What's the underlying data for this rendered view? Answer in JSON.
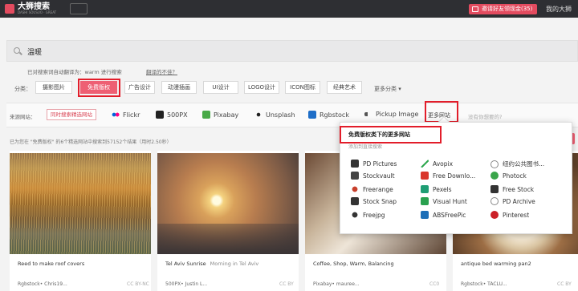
{
  "topbar": {
    "logo_text": "大狮搜索",
    "logo_sub": "DASHI SOUSUO · GREAT",
    "invite_label": "邀请好友领现金(35)",
    "user_label": "我的大狮"
  },
  "search": {
    "query": "温暖",
    "translate_note": "已对搜索词自动翻译为：warm 进行搜索",
    "unsatisfied": "翻译的不佳？"
  },
  "categories": {
    "label": "分类：",
    "items": [
      "摄影图片",
      "免费版权",
      "广告设计",
      "动漫插画",
      "UI设计",
      "LOGO设计",
      "ICON图标",
      "经典艺术"
    ],
    "active": "免费版权",
    "more": "更多分类 ▾"
  },
  "sources": {
    "label": "来源网站：",
    "selected": "同时搜索精选网站",
    "items": [
      "Flickr",
      "500PX",
      "Pixabay",
      "Unsplash",
      "Rgbstock",
      "Pickup Image"
    ],
    "more": "更多网站",
    "hint": "没有你想要的?"
  },
  "result_text": "已为您在 \"免费版权\" 的6个精选网站中搜索到57152个结果（用时2.50秒）",
  "dropdown": {
    "title": "免费版权类下的更多网站",
    "subtitle": "添加到直接搜索",
    "col1": [
      "PD Pictures",
      "Stockvault",
      "Freerange",
      "Stock Snap",
      "Freejpg"
    ],
    "col2": [
      "Avopix",
      "Free Downlo...",
      "Pexels",
      "Visual Hunt",
      "ABSFreePic"
    ],
    "col3": [
      "纽约公共图书...",
      "Photock",
      "Free Stock",
      "PD Archive",
      "Pinterest"
    ]
  },
  "cards": [
    {
      "title": "Reed to make roof covers",
      "subtitle": "",
      "meta": "Rgbstock• Chris19...",
      "license": "CC BY-NC"
    },
    {
      "title": "Tel Aviv Sunrise",
      "subtitle": "Morning in Tel Aviv",
      "meta": "500PX• Justin L...",
      "license": "CC BY"
    },
    {
      "title": "Coffee, Shop, Warm, Balancing",
      "subtitle": "",
      "meta": "Pixabay• mauree...",
      "license": "CC0"
    },
    {
      "title": "antique bed warming pan2",
      "subtitle": "",
      "meta": "Rgbstock• TACLU...",
      "license": "CC BY"
    }
  ],
  "colors": {
    "accent": "#ee5f73",
    "highlight_box": "#e21d2a",
    "topbar": "#2e2f33"
  }
}
